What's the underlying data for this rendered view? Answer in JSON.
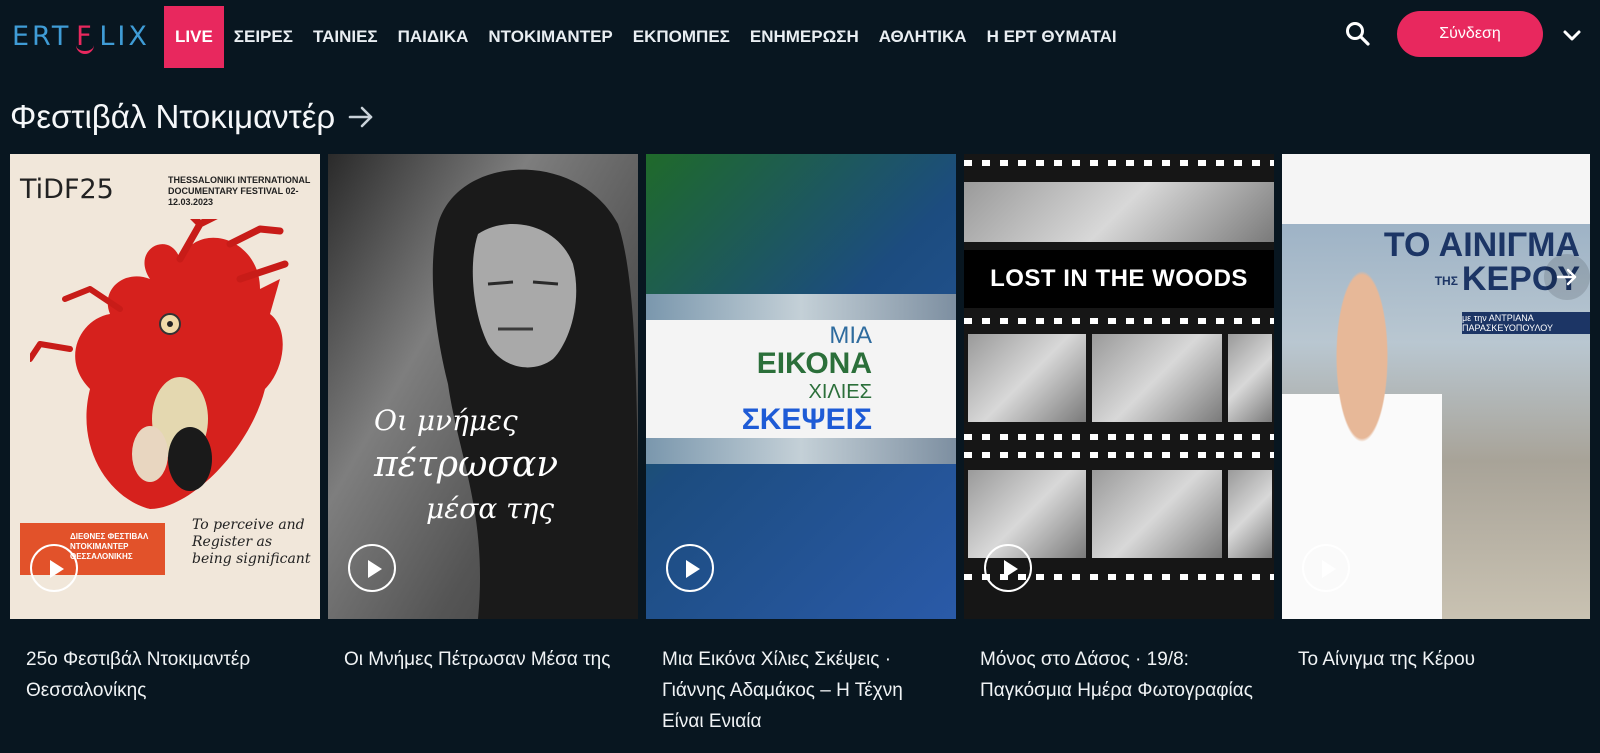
{
  "header": {
    "logo": {
      "left": "ERT",
      "right": "LIX"
    },
    "nav": [
      "LIVE",
      "ΣΕΙΡΕΣ",
      "ΤΑΙΝΙΕΣ",
      "ΠΑΙΔΙΚΑ",
      "ΝΤΟΚΙΜΑΝΤΕΡ",
      "ΕΚΠΟΜΠΕΣ",
      "ΕΝΗΜΕΡΩΣΗ",
      "ΑΘΛΗΤΙΚΑ",
      "Η ΕΡΤ ΘΥΜΑΤΑΙ"
    ],
    "login_label": "Σύνδεση",
    "icons": {
      "search": "search-icon",
      "menu": "chevron-down-icon"
    },
    "colors": {
      "accent": "#e8285e",
      "logo_blue": "#3f9cd6",
      "background": "#081620"
    }
  },
  "section": {
    "title": "Φεστιβάλ Ντοκιμαντέρ"
  },
  "cards": [
    {
      "title": "25ο Φεστιβάλ Ντοκιμαντέρ Θεσσαλονίκης",
      "poster": {
        "tidf": "TiDF25",
        "festival": "THESSALONIKI INTERNATIONAL DOCUMENTARY FESTIVAL 02-12.03.2023",
        "redbox": "ΔΙΕΘΝΕΣ ΦΕΣΤΙΒΑΛ ΝΤΟΚΙΜΑΝΤΕΡ ΘΕΣΣΑΛΟΝΙΚΗΣ",
        "script": "To perceive and Register as being significant"
      }
    },
    {
      "title": "Οι Μνήμες Πέτρωσαν Μέσα της",
      "poster": {
        "line1": "Οι μνήμες",
        "line2": "πέτρωσαν",
        "line3": "μέσα της"
      }
    },
    {
      "title": "Μια Εικόνα Χίλιες Σκέψεις · Γιάννης Αδαμάκος – Η Τέχνη Είναι Ενιαία",
      "poster": {
        "line1": "ΜΙΑ",
        "line2": "ΕΙΚΟΝΑ",
        "line3": "ΧΙΛΙΕΣ",
        "line4": "ΣΚΕΨΕΙΣ"
      }
    },
    {
      "title": "Μόνος στο Δάσος · 19/8: Παγκόσμια Ημέρα Φωτογραφίας",
      "poster": {
        "lost": "LOST IN THE WOODS"
      }
    },
    {
      "title": "Το Αίνιγμα της Κέρου",
      "poster": {
        "line1": "ΤΟ ΑΙΝΙΓΜΑ",
        "line2": "ΚΕΡΟΥ",
        "small": "ΤΗΣ",
        "sub": "με την ΑΝΤΡΙΑΝΑ ΠΑΡΑΣΚΕΥΟΠΟΥΛΟΥ"
      }
    }
  ]
}
